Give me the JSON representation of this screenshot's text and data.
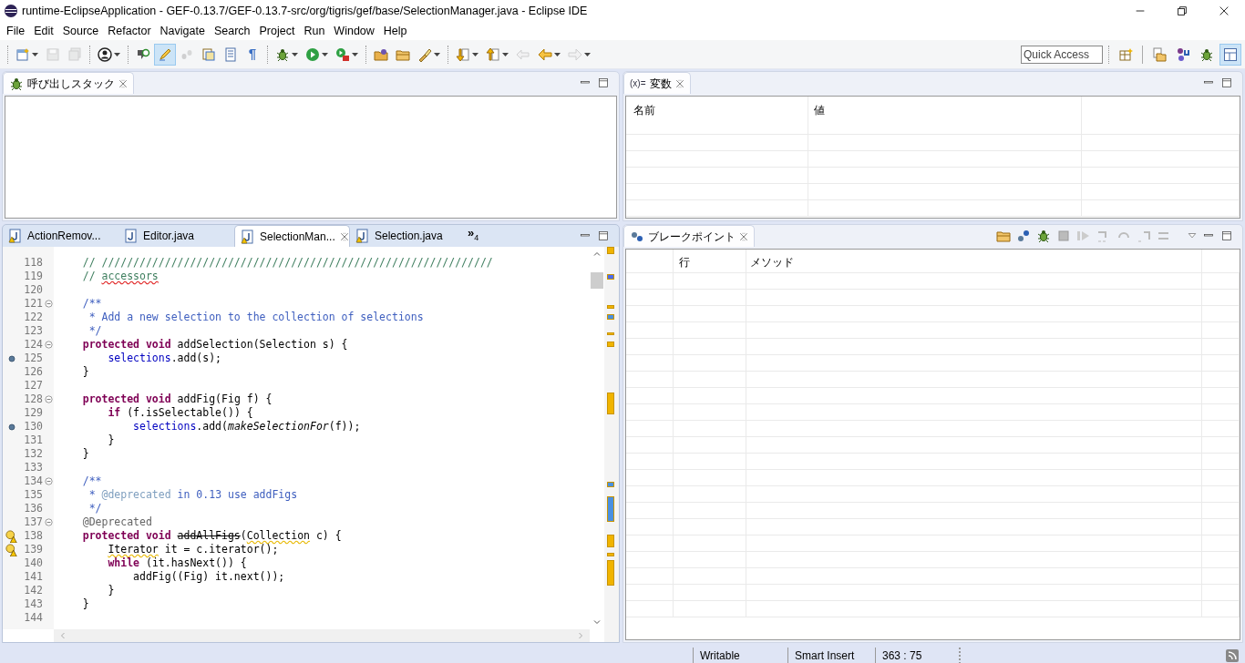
{
  "window": {
    "title": "runtime-EclipseApplication - GEF-0.13.7/GEF-0.13.7-src/org/tigris/gef/base/SelectionManager.java - Eclipse IDE"
  },
  "menu": [
    "File",
    "Edit",
    "Source",
    "Refactor",
    "Navigate",
    "Search",
    "Project",
    "Run",
    "Window",
    "Help"
  ],
  "toolbar": [
    {
      "kind": "new",
      "dropdown": true,
      "disabled": false,
      "selected": false
    },
    {
      "kind": "save",
      "dropdown": false,
      "disabled": true,
      "selected": false
    },
    {
      "kind": "save-all",
      "dropdown": false,
      "disabled": true,
      "selected": false
    },
    {
      "kind": "separator"
    },
    {
      "kind": "person",
      "dropdown": true,
      "disabled": false,
      "selected": false
    },
    {
      "kind": "separator"
    },
    {
      "kind": "pin",
      "dropdown": false,
      "disabled": false,
      "selected": false
    },
    {
      "kind": "highlighter",
      "dropdown": false,
      "disabled": false,
      "selected": true
    },
    {
      "kind": "footprints",
      "dropdown": false,
      "disabled": true,
      "selected": false
    },
    {
      "kind": "block",
      "dropdown": false,
      "disabled": false,
      "selected": false
    },
    {
      "kind": "page",
      "dropdown": false,
      "disabled": false,
      "selected": false
    },
    {
      "kind": "glyph",
      "text": "¶",
      "dropdown": false,
      "disabled": false,
      "selected": false
    },
    {
      "kind": "separator"
    },
    {
      "kind": "bug",
      "dropdown": true,
      "disabled": false,
      "selected": false
    },
    {
      "kind": "play",
      "dropdown": true,
      "disabled": false,
      "selected": false
    },
    {
      "kind": "run-tool",
      "dropdown": true,
      "disabled": false,
      "selected": false
    },
    {
      "kind": "separator"
    },
    {
      "kind": "folder-globe",
      "dropdown": false,
      "disabled": false,
      "selected": false
    },
    {
      "kind": "folder",
      "dropdown": false,
      "disabled": false,
      "selected": false
    },
    {
      "kind": "flashlight",
      "dropdown": true,
      "disabled": false,
      "selected": false
    },
    {
      "kind": "separator"
    },
    {
      "kind": "arrow-down-doc",
      "dropdown": true,
      "disabled": false,
      "selected": false
    },
    {
      "kind": "arrow-up-doc",
      "dropdown": true,
      "disabled": false,
      "selected": false
    },
    {
      "kind": "back-pen",
      "dropdown": false,
      "disabled": true,
      "selected": false
    },
    {
      "kind": "back",
      "dropdown": true,
      "disabled": false,
      "selected": false
    },
    {
      "kind": "forward",
      "dropdown": true,
      "disabled": true,
      "selected": false
    }
  ],
  "quick_access": {
    "placeholder": "Quick Access"
  },
  "perspectives": [
    {
      "kind": "open-perspective",
      "selected": false
    },
    {
      "kind": "separator"
    },
    {
      "kind": "java-ee",
      "selected": false
    },
    {
      "kind": "git",
      "selected": false
    },
    {
      "kind": "bug",
      "selected": false
    },
    {
      "kind": "resource",
      "selected": true
    }
  ],
  "call_stack_view": {
    "title": "呼び出しスタック"
  },
  "variables_view": {
    "icon_text": "(x)=",
    "title": "変数",
    "columns": [
      "名前",
      "値"
    ]
  },
  "editor": {
    "tabs": [
      {
        "label": "ActionRemov...",
        "warning": true,
        "selected": false
      },
      {
        "label": "Editor.java",
        "warning": false,
        "selected": false
      },
      {
        "label": "SelectionMan...",
        "warning": true,
        "selected": true
      },
      {
        "label": "Selection.java",
        "warning": true,
        "selected": false
      }
    ],
    "overflow": {
      "glyph": "»",
      "count": "4"
    },
    "lines": [
      {
        "number": "118",
        "fold": false,
        "breakpoint": false,
        "warning": false,
        "tokens": [
          {
            "kind": "comment",
            "text": "    // //////////////////////////////////////////////////////////////"
          }
        ]
      },
      {
        "number": "119",
        "fold": false,
        "breakpoint": false,
        "warning": false,
        "tokens": [
          {
            "kind": "comment",
            "text": "    // "
          },
          {
            "kind": "misspelled-comment",
            "text": "accessors"
          }
        ]
      },
      {
        "number": "120",
        "fold": false,
        "breakpoint": false,
        "warning": false
      },
      {
        "number": "121",
        "fold": true,
        "breakpoint": false,
        "warning": false,
        "tokens": [
          {
            "kind": "javadoc",
            "text": "    /**"
          }
        ]
      },
      {
        "number": "122",
        "fold": false,
        "breakpoint": false,
        "warning": false,
        "tokens": [
          {
            "kind": "javadoc",
            "text": "     * Add a new selection to the collection of selections"
          }
        ]
      },
      {
        "number": "123",
        "fold": false,
        "breakpoint": false,
        "warning": false,
        "tokens": [
          {
            "kind": "javadoc",
            "text": "     */"
          }
        ]
      },
      {
        "number": "124",
        "fold": true,
        "breakpoint": false,
        "warning": false,
        "tokens": [
          {
            "kind": "keyword",
            "text": "    protected void"
          },
          {
            "kind": "plain",
            "text": " addSelection(Selection s) {"
          }
        ]
      },
      {
        "number": "125",
        "fold": false,
        "breakpoint": true,
        "warning": false,
        "tokens": [
          {
            "kind": "field",
            "text": "        selections"
          },
          {
            "kind": "plain",
            "text": ".add(s);"
          }
        ]
      },
      {
        "number": "126",
        "fold": false,
        "breakpoint": false,
        "warning": false,
        "tokens": [
          {
            "kind": "plain",
            "text": "    }"
          }
        ]
      },
      {
        "number": "127",
        "fold": false,
        "breakpoint": false,
        "warning": false
      },
      {
        "number": "128",
        "fold": true,
        "breakpoint": false,
        "warning": false,
        "tokens": [
          {
            "kind": "keyword",
            "text": "    protected void"
          },
          {
            "kind": "plain",
            "text": " addFig(Fig f) {"
          }
        ]
      },
      {
        "number": "129",
        "fold": false,
        "breakpoint": false,
        "warning": false,
        "tokens": [
          {
            "kind": "keyword",
            "text": "        if"
          },
          {
            "kind": "plain",
            "text": " (f.isSelectable()) {"
          }
        ]
      },
      {
        "number": "130",
        "fold": false,
        "breakpoint": true,
        "warning": false,
        "tokens": [
          {
            "kind": "field",
            "text": "            selections"
          },
          {
            "kind": "plain",
            "text": ".add("
          },
          {
            "kind": "italic",
            "text": "makeSelectionFor"
          },
          {
            "kind": "plain",
            "text": "(f));"
          }
        ]
      },
      {
        "number": "131",
        "fold": false,
        "breakpoint": false,
        "warning": false,
        "tokens": [
          {
            "kind": "plain",
            "text": "        }"
          }
        ]
      },
      {
        "number": "132",
        "fold": false,
        "breakpoint": false,
        "warning": false,
        "tokens": [
          {
            "kind": "plain",
            "text": "    }"
          }
        ]
      },
      {
        "number": "133",
        "fold": false,
        "breakpoint": false,
        "warning": false
      },
      {
        "number": "134",
        "fold": true,
        "breakpoint": false,
        "warning": false,
        "tokens": [
          {
            "kind": "javadoc",
            "text": "    /**"
          }
        ]
      },
      {
        "number": "135",
        "fold": false,
        "breakpoint": false,
        "warning": false,
        "tokens": [
          {
            "kind": "javadoc",
            "text": "     * "
          },
          {
            "kind": "javadoc-tag",
            "text": "@deprecated"
          },
          {
            "kind": "javadoc",
            "text": " in 0.13 use addFigs"
          }
        ]
      },
      {
        "number": "136",
        "fold": false,
        "breakpoint": false,
        "warning": false,
        "tokens": [
          {
            "kind": "javadoc",
            "text": "     */"
          }
        ]
      },
      {
        "number": "137",
        "fold": true,
        "breakpoint": false,
        "warning": false,
        "tokens": [
          {
            "kind": "annotation",
            "text": "    @Deprecated"
          }
        ]
      },
      {
        "number": "138",
        "fold": false,
        "breakpoint": false,
        "warning": true,
        "tokens": [
          {
            "kind": "keyword",
            "text": "    protected void "
          },
          {
            "kind": "deprecated",
            "text": "addAllFigs"
          },
          {
            "kind": "plain",
            "text": "("
          },
          {
            "kind": "flagged",
            "text": "Collection"
          },
          {
            "kind": "plain",
            "text": " c) {"
          }
        ]
      },
      {
        "number": "139",
        "fold": false,
        "breakpoint": false,
        "warning": true,
        "tokens": [
          {
            "kind": "flagged",
            "text": "        Iterator"
          },
          {
            "kind": "plain",
            "text": " it = c.iterator();"
          }
        ]
      },
      {
        "number": "140",
        "fold": false,
        "breakpoint": false,
        "warning": false,
        "tokens": [
          {
            "kind": "keyword",
            "text": "        while"
          },
          {
            "kind": "plain",
            "text": " (it.hasNext()) {"
          }
        ]
      },
      {
        "number": "141",
        "fold": false,
        "breakpoint": false,
        "warning": false,
        "tokens": [
          {
            "kind": "plain",
            "text": "            addFig((Fig) it.next());"
          }
        ]
      },
      {
        "number": "142",
        "fold": false,
        "breakpoint": false,
        "warning": false,
        "tokens": [
          {
            "kind": "plain",
            "text": "        }"
          }
        ]
      },
      {
        "number": "143",
        "fold": false,
        "breakpoint": false,
        "warning": false,
        "tokens": [
          {
            "kind": "plain",
            "text": "    }"
          }
        ]
      },
      {
        "number": "144",
        "fold": false,
        "breakpoint": false,
        "warning": false
      }
    ]
  },
  "breakpoints_view": {
    "title": "ブレークポイント",
    "columns": [
      "行",
      "メソッド"
    ]
  },
  "status_bar": [
    "Writable",
    "Smart Insert",
    "363 : 75"
  ]
}
